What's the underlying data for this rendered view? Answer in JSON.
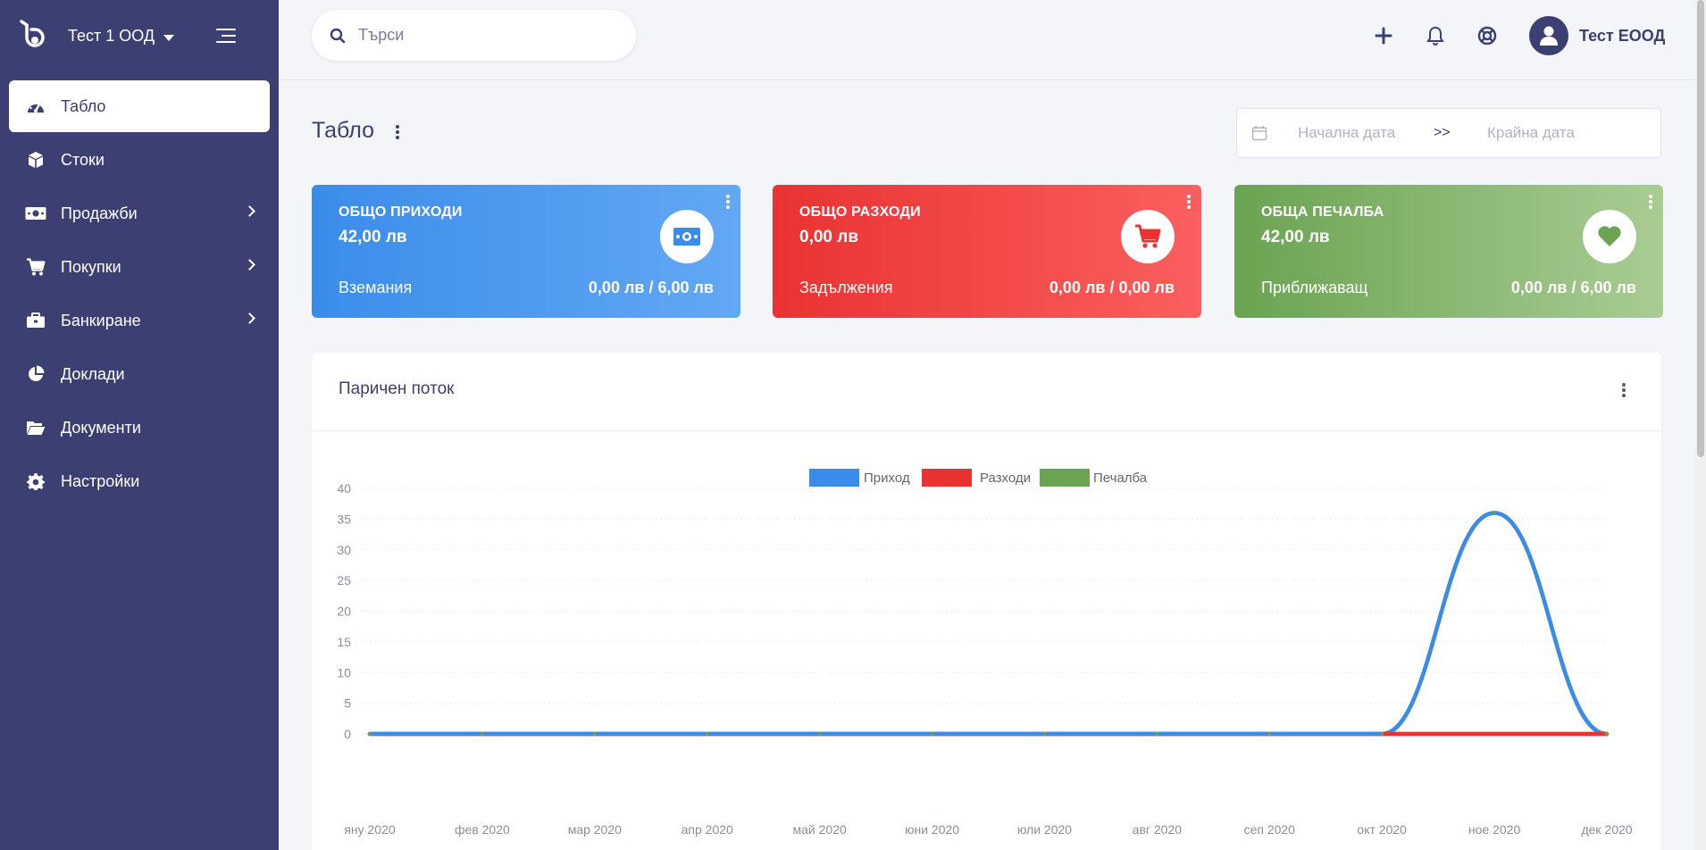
{
  "sidebar": {
    "company": "Тест 1 ООД",
    "items": [
      {
        "label": "Табло",
        "icon": "speedometer-icon",
        "active": true
      },
      {
        "label": "Стоки",
        "icon": "box-icon"
      },
      {
        "label": "Продажби",
        "icon": "money-icon",
        "submenu": true
      },
      {
        "label": "Покупки",
        "icon": "cart-icon",
        "submenu": true
      },
      {
        "label": "Банкиране",
        "icon": "briefcase-icon",
        "submenu": true
      },
      {
        "label": "Доклади",
        "icon": "pie-chart-icon"
      },
      {
        "label": "Документи",
        "icon": "folder-open-icon"
      },
      {
        "label": "Настройки",
        "icon": "gear-icon"
      }
    ]
  },
  "header": {
    "search_placeholder": "Търси",
    "user_name": "Тест ЕООД"
  },
  "page": {
    "title": "Табло",
    "date_start_placeholder": "Начална дата",
    "date_separator": ">>",
    "date_end_placeholder": "Крайна дата"
  },
  "cards": [
    {
      "label": "ОБЩО ПРИХОДИ",
      "amount": "42,00 лв",
      "foot_label": "Вземания",
      "foot_value": "0,00 лв / 6,00 лв",
      "icon": "money-icon",
      "color": "#3b8cea"
    },
    {
      "label": "ОБЩО РАЗХОДИ",
      "amount": "0,00 лв",
      "foot_label": "Задължения",
      "foot_value": "0,00 лв / 0,00 лв",
      "icon": "cart-icon",
      "color": "#ea3232"
    },
    {
      "label": "ОБЩА ПЕЧАЛБА",
      "amount": "42,00 лв",
      "foot_label": "Приближаващ",
      "foot_value": "0,00 лв / 6,00 лв",
      "icon": "heart-icon",
      "color": "#6aa352"
    }
  ],
  "panel": {
    "title": "Паричен поток"
  },
  "chart_data": {
    "type": "line",
    "title": "",
    "categories": [
      "яну 2020",
      "фев 2020",
      "мар 2020",
      "апр 2020",
      "май 2020",
      "юни 2020",
      "юли 2020",
      "авг 2020",
      "сеп 2020",
      "окт 2020",
      "ное 2020",
      "дек 2020"
    ],
    "series": [
      {
        "name": "Приход",
        "color": "#3b8cea",
        "values": [
          0,
          0,
          0,
          0,
          0,
          0,
          0,
          0,
          0,
          0,
          36,
          0
        ]
      },
      {
        "name": "Разходи",
        "color": "#ea3232",
        "values": [
          0,
          0,
          0,
          0,
          0,
          0,
          0,
          0,
          0,
          0,
          0,
          0
        ]
      },
      {
        "name": "Печалба",
        "color": "#6aa352",
        "values": [
          0,
          0,
          0,
          0,
          0,
          0,
          0,
          0,
          0,
          0,
          36,
          0
        ]
      }
    ],
    "ylim": [
      0,
      40
    ],
    "yticks": [
      0,
      5,
      10,
      15,
      20,
      25,
      30,
      35,
      40
    ],
    "legend": "top-center",
    "grid": true
  }
}
